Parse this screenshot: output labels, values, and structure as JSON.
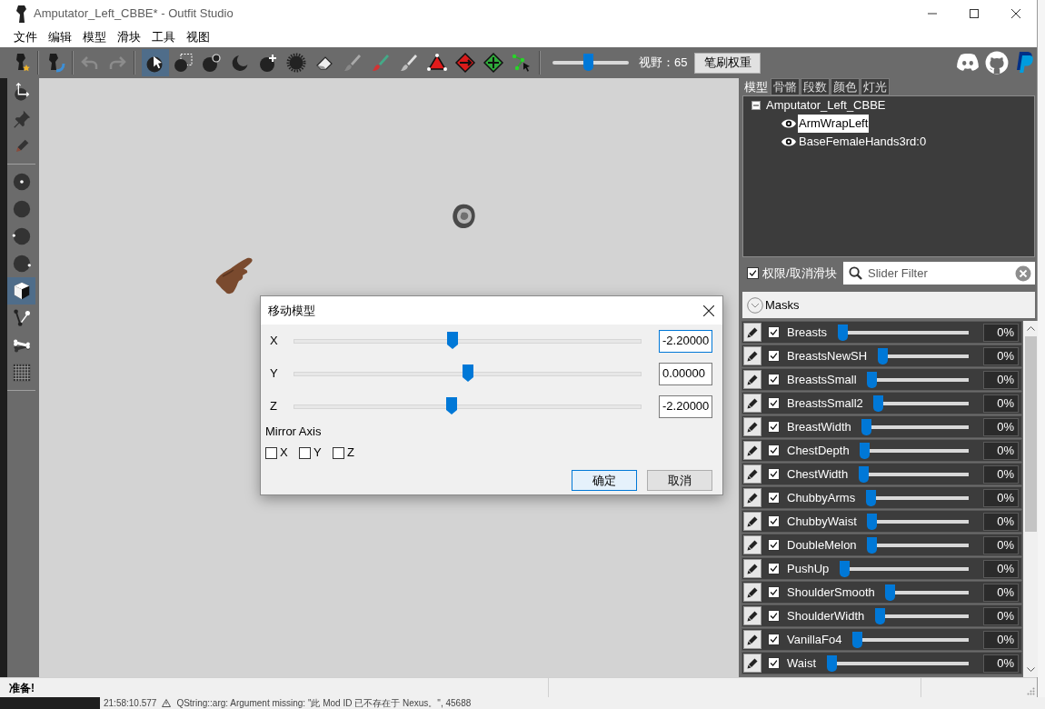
{
  "window": {
    "title": "Amputator_Left_CBBE* - Outfit Studio"
  },
  "menu": [
    "文件",
    "编辑",
    "模型",
    "滑块",
    "工具",
    "视图"
  ],
  "toolbar": {
    "history": [
      {
        "disabled": true
      },
      {
        "disabled": true
      }
    ],
    "tools": [
      {
        "selected": true
      },
      {
        "selected": false
      },
      {
        "selected": false
      },
      {
        "selected": false
      },
      {
        "selected": false
      },
      {
        "selected": false
      },
      {
        "selected": false
      },
      {
        "selected": false
      },
      {
        "selected": false
      },
      {
        "selected": false
      },
      {
        "selected": false
      },
      {
        "selected": false
      },
      {
        "selected": false
      },
      {
        "selected": false
      }
    ],
    "fov": {
      "level": 0.46,
      "label": "视野：65"
    },
    "brush_button": "笔刷权重"
  },
  "side_tool_groups": [
    {
      "tools": [
        {
          "selected": false
        },
        {
          "selected": false
        },
        {
          "selected": false
        }
      ]
    },
    {
      "tools": [
        {
          "selected": false
        },
        {
          "selected": false
        },
        {
          "selected": false
        },
        {
          "selected": false
        },
        {
          "selected": true
        },
        {
          "selected": false
        },
        {
          "selected": false
        },
        {
          "selected": false
        }
      ]
    }
  ],
  "panel_tabs": [
    {
      "label": "模型",
      "selected": true
    },
    {
      "label": "骨骼",
      "selected": false
    },
    {
      "label": "段数",
      "selected": false
    },
    {
      "label": "颜色",
      "selected": false
    },
    {
      "label": "灯光",
      "selected": false
    }
  ],
  "mesh_tree": {
    "label": "Amputator_Left_CBBE",
    "expanded": true,
    "children": [
      {
        "label": "ArmWrapLeft",
        "selected": true
      },
      {
        "label": "BaseFemaleHands3rd:0",
        "selected": false
      }
    ]
  },
  "slider_toggle": {
    "label": "权限/取消滑块",
    "checked": true
  },
  "slider_filter": {
    "placeholder": "Slider Filter"
  },
  "slider_group": {
    "label": "Masks"
  },
  "sliders": [
    {
      "name": "Breasts",
      "checked": true,
      "level": 0,
      "value": "0%"
    },
    {
      "name": "BreastsNewSH",
      "checked": true,
      "level": 0,
      "value": "0%"
    },
    {
      "name": "BreastsSmall",
      "checked": true,
      "level": 0,
      "value": "0%"
    },
    {
      "name": "BreastsSmall2",
      "checked": true,
      "level": 0,
      "value": "0%"
    },
    {
      "name": "BreastWidth",
      "checked": true,
      "level": 0,
      "value": "0%"
    },
    {
      "name": "ChestDepth",
      "checked": true,
      "level": 0,
      "value": "0%"
    },
    {
      "name": "ChestWidth",
      "checked": true,
      "level": 0,
      "value": "0%"
    },
    {
      "name": "ChubbyArms",
      "checked": true,
      "level": 0,
      "value": "0%"
    },
    {
      "name": "ChubbyWaist",
      "checked": true,
      "level": 0,
      "value": "0%"
    },
    {
      "name": "DoubleMelon",
      "checked": true,
      "level": 0,
      "value": "0%"
    },
    {
      "name": "PushUp",
      "checked": true,
      "level": 0,
      "value": "0%"
    },
    {
      "name": "ShoulderSmooth",
      "checked": true,
      "level": 0,
      "value": "0%"
    },
    {
      "name": "ShoulderWidth",
      "checked": true,
      "level": 0,
      "value": "0%"
    },
    {
      "name": "VanillaFo4",
      "checked": true,
      "level": 0,
      "value": "0%"
    },
    {
      "name": "Waist",
      "checked": true,
      "level": 0,
      "value": "0%"
    }
  ],
  "dialog": {
    "title": "移动模型",
    "axes": [
      {
        "label": "X",
        "level": 0.457,
        "value": "-2.20000",
        "focused": true
      },
      {
        "label": "Y",
        "level": 0.5,
        "value": "0.00000",
        "focused": false
      },
      {
        "label": "Z",
        "level": 0.455,
        "value": "-2.20000",
        "focused": false
      }
    ],
    "mirror_label": "Mirror Axis",
    "mirror": [
      {
        "label": "X",
        "checked": false
      },
      {
        "label": "Y",
        "checked": false
      },
      {
        "label": "Z",
        "checked": false
      }
    ],
    "buttons": [
      {
        "label": "确定",
        "default": true
      },
      {
        "label": "取消",
        "default": false
      }
    ]
  },
  "status_bar": {
    "text": "准备!"
  },
  "background_log": {
    "time": "21:58:10.577",
    "message": "QString::arg: Argument missing: \"此 Mod ID 已不存在于 Nexus。\", 45688"
  }
}
